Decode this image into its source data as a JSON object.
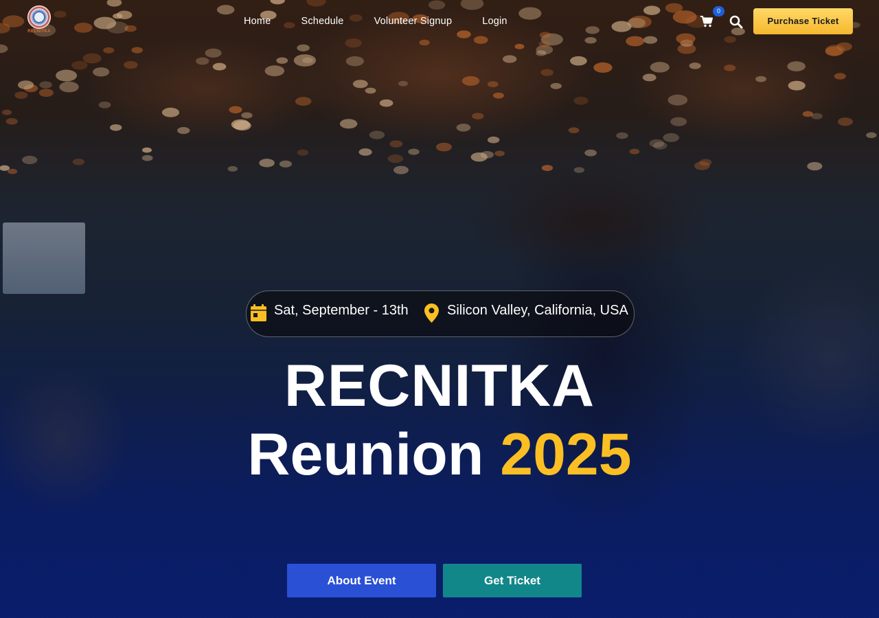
{
  "brand": {
    "logo_icon": "recnitka-logo",
    "logo_text": "RECNITKA"
  },
  "nav": {
    "items": [
      {
        "label": "Home"
      },
      {
        "label": "Schedule"
      },
      {
        "label": "Volunteer Signup"
      },
      {
        "label": "Login"
      }
    ]
  },
  "header_actions": {
    "cart_icon": "cart-icon",
    "cart_count": "0",
    "search_icon": "search-icon",
    "purchase_label": "Purchase Ticket"
  },
  "event": {
    "date_icon": "calendar-icon",
    "date": "Sat, September - 13th",
    "location_icon": "location-pin-icon",
    "location": "Silicon Valley, California, USA",
    "title_line1": "RECNITKA",
    "title_line2_prefix": "Reunion",
    "title_year": "2025"
  },
  "cta": {
    "about_label": "About Event",
    "ticket_label": "Get Ticket"
  },
  "colors": {
    "accent_yellow": "#fbbf24",
    "button_blue": "#2a50d6",
    "button_teal": "#11878a",
    "purchase_gold": "#f5b82e",
    "badge_blue": "#1f5fd8"
  }
}
